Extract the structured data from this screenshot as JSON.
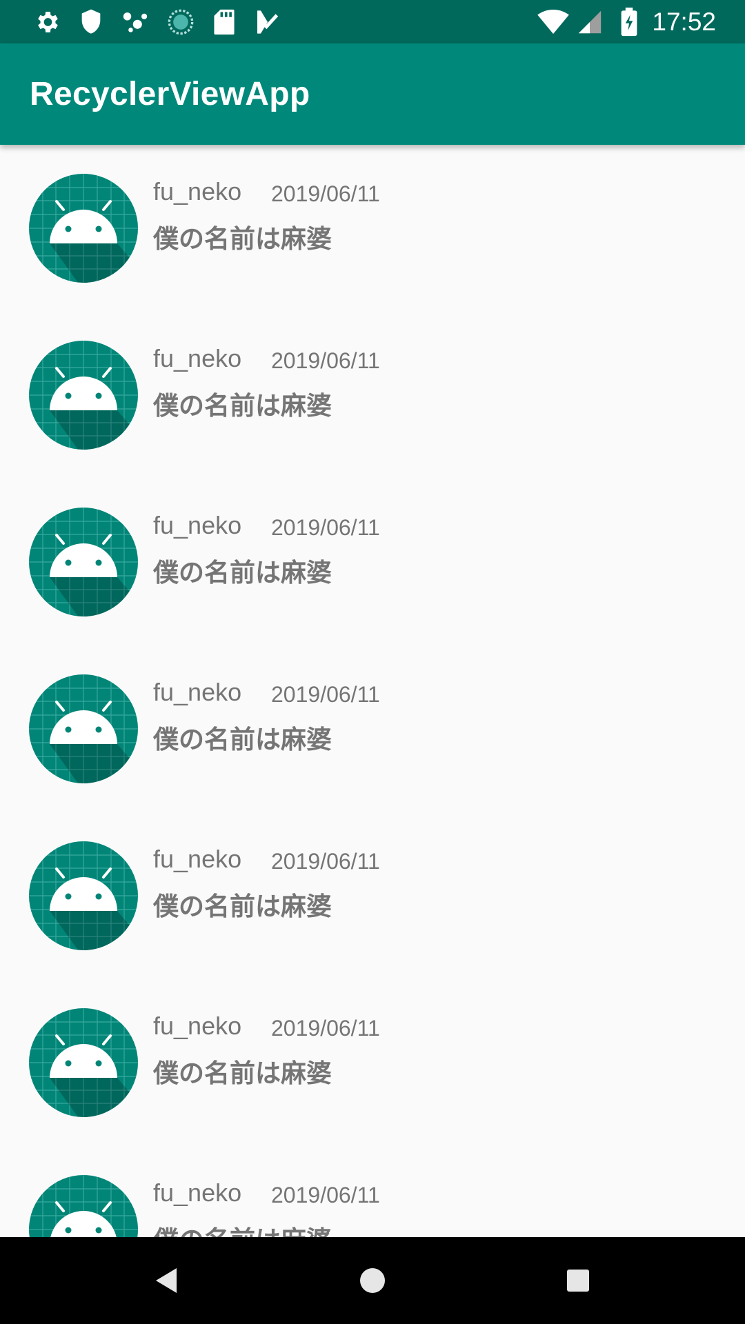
{
  "status_bar": {
    "time": "17:52",
    "left_icons": [
      "settings-icon",
      "shield-icon",
      "assistant-icon",
      "sync-icon",
      "sd-card-icon",
      "task-icon"
    ],
    "right_icons": [
      "wifi-icon",
      "cell-signal-icon",
      "battery-charging-icon"
    ]
  },
  "app_bar": {
    "title": "RecyclerViewApp",
    "color": "#00897b",
    "status_color": "#00695c"
  },
  "list": {
    "items": [
      {
        "name": "fu_neko",
        "date": "2019/06/11",
        "message": "僕の名前は麻婆",
        "avatar_icon": "android-icon"
      },
      {
        "name": "fu_neko",
        "date": "2019/06/11",
        "message": "僕の名前は麻婆",
        "avatar_icon": "android-icon"
      },
      {
        "name": "fu_neko",
        "date": "2019/06/11",
        "message": "僕の名前は麻婆",
        "avatar_icon": "android-icon"
      },
      {
        "name": "fu_neko",
        "date": "2019/06/11",
        "message": "僕の名前は麻婆",
        "avatar_icon": "android-icon"
      },
      {
        "name": "fu_neko",
        "date": "2019/06/11",
        "message": "僕の名前は麻婆",
        "avatar_icon": "android-icon"
      },
      {
        "name": "fu_neko",
        "date": "2019/06/11",
        "message": "僕の名前は麻婆",
        "avatar_icon": "android-icon"
      },
      {
        "name": "fu_neko",
        "date": "2019/06/11",
        "message": "僕の名前は麻婆",
        "avatar_icon": "android-icon"
      }
    ]
  },
  "nav_bar": {
    "buttons": [
      "back-icon",
      "home-icon",
      "recent-apps-icon"
    ]
  }
}
